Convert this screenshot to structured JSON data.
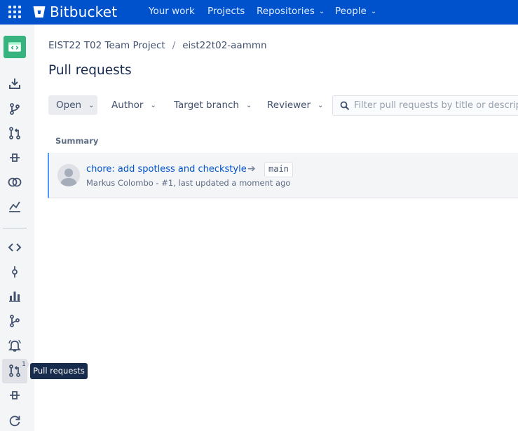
{
  "app": {
    "name": "Bitbucket"
  },
  "topnav": [
    {
      "label": "Your work",
      "dropdown": false
    },
    {
      "label": "Projects",
      "dropdown": false
    },
    {
      "label": "Repositories",
      "dropdown": true
    },
    {
      "label": "People",
      "dropdown": true
    }
  ],
  "breadcrumb": {
    "project": "EIST22 T02 Team Project",
    "repository": "eist22t02-aammn"
  },
  "page": {
    "title": "Pull requests"
  },
  "filters": {
    "state": "Open",
    "author": "Author",
    "target_branch": "Target branch",
    "reviewer": "Reviewer",
    "search_placeholder": "Filter pull requests by title or description"
  },
  "table": {
    "columns": [
      "Summary"
    ],
    "rows": [
      {
        "title": "chore: add spotless and checkstyle",
        "target_branch": "main",
        "meta": "Markus Colombo - #1, last updated a moment ago"
      }
    ]
  },
  "sidebar": {
    "tooltip": "Pull requests",
    "pr_badge": "1",
    "icons": [
      "download-icon",
      "branch-merge-icon",
      "pull-request-icon",
      "pipeline-icon",
      "deployments-icon",
      "insights-icon",
      "source-icon",
      "commits-icon",
      "reports-icon",
      "branches-icon",
      "bell-icon",
      "pull-requests-active-icon",
      "pipelines-icon",
      "sync-icon"
    ]
  },
  "colors": {
    "brand": "#0052cc",
    "accent": "#4c9aff",
    "project": "#36b37e"
  }
}
